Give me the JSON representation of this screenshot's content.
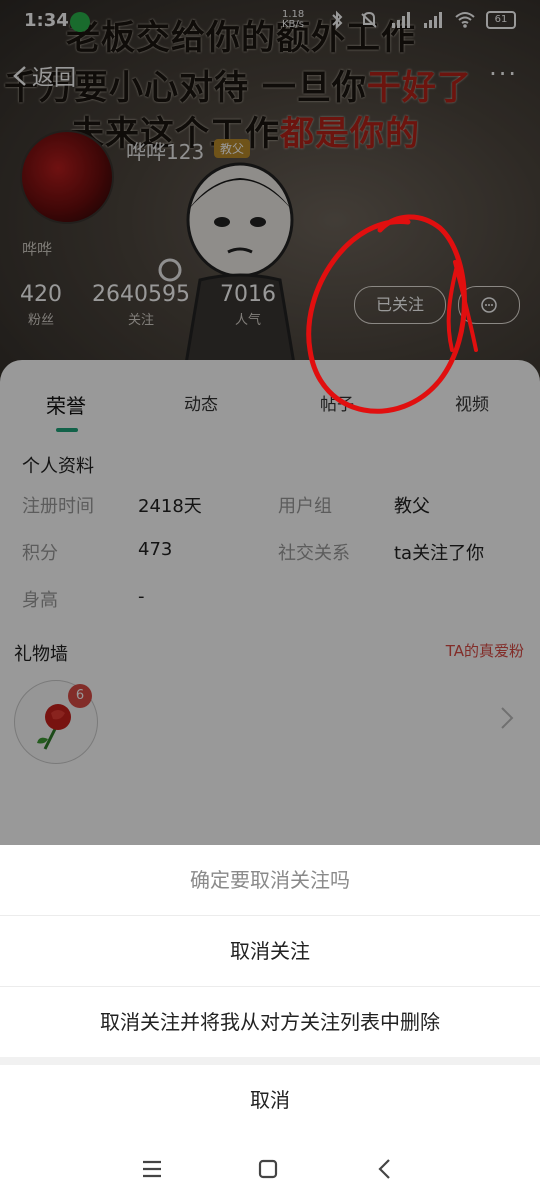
{
  "status": {
    "time": "1:34",
    "net_speed": "1.18 KB/s",
    "battery": "61"
  },
  "meme": {
    "line1": "老板交给你的额外工作",
    "line2_a": "千万要小心对待 一旦你",
    "line2_b": "干好了",
    "line3_a": "未来这个工作",
    "line3_b": "都是你的"
  },
  "header": {
    "back_label": "返回",
    "username": "哗哗123",
    "badge": "教父",
    "signature": "哗哗",
    "stats": [
      {
        "value": "420",
        "label": "粉丝"
      },
      {
        "value": "2640595",
        "label": "关注"
      },
      {
        "value": "7016",
        "label": "人气"
      }
    ],
    "follow_label": "已关注"
  },
  "tabs": [
    "荣誉",
    "动态",
    "帖子",
    "视频"
  ],
  "profile": {
    "title": "个人资料",
    "rows": [
      {
        "label1": "注册时间",
        "value1": "2418天",
        "label2": "用户组",
        "value2": "教父"
      },
      {
        "label1": "积分",
        "value1": "473",
        "label2": "社交关系",
        "value2": "ta关注了你"
      },
      {
        "label1": "身高",
        "value1": "-",
        "label2": "",
        "value2": ""
      }
    ]
  },
  "gift_wall": {
    "title": "礼物墙",
    "link": "TA的真爱粉",
    "count": "6"
  },
  "sheet": {
    "title": "确定要取消关注吗",
    "option1": "取消关注",
    "option2": "取消关注并将我从对方关注列表中删除",
    "cancel": "取消"
  },
  "colors": {
    "accent": "#1fa37a",
    "link_red": "#d94b45",
    "annotation_red": "#e10f0f"
  }
}
